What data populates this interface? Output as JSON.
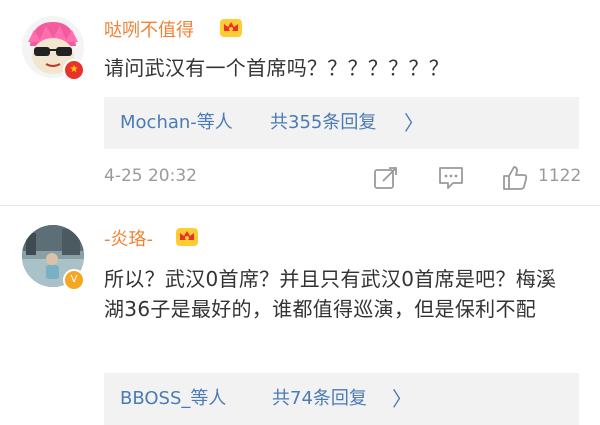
{
  "comments": [
    {
      "username": "哒咧不值得",
      "text": "请问武汉有一个首席吗？？？？？？？",
      "replies": {
        "names": "Mochan-等人",
        "count_label": "共355条回复",
        "chevron": "〉"
      },
      "timestamp": "4-25 20:32",
      "likes": "1122",
      "icons": [
        "avatar-sunglasses-icon",
        "verified-badge-icon",
        "crown-badge-icon",
        "repost-icon",
        "comment-icon",
        "like-icon"
      ]
    },
    {
      "username": "-炎珞-",
      "text": "所以？武汉0首席？并且只有武汉0首席是吧？梅溪湖36子是最好的，谁都值得巡演，但是保利不配",
      "replies": {
        "names": "BBOSS_等人",
        "count_label": "共74条回复",
        "chevron": "〉"
      },
      "icons": [
        "avatar-photo-icon",
        "verified-badge-icon",
        "crown-badge-icon"
      ]
    }
  ],
  "colors": {
    "username": "#f08236",
    "reply_link": "#4a7bb7",
    "reply_bg": "#f2f2f2",
    "meta": "#9a9a9a"
  }
}
